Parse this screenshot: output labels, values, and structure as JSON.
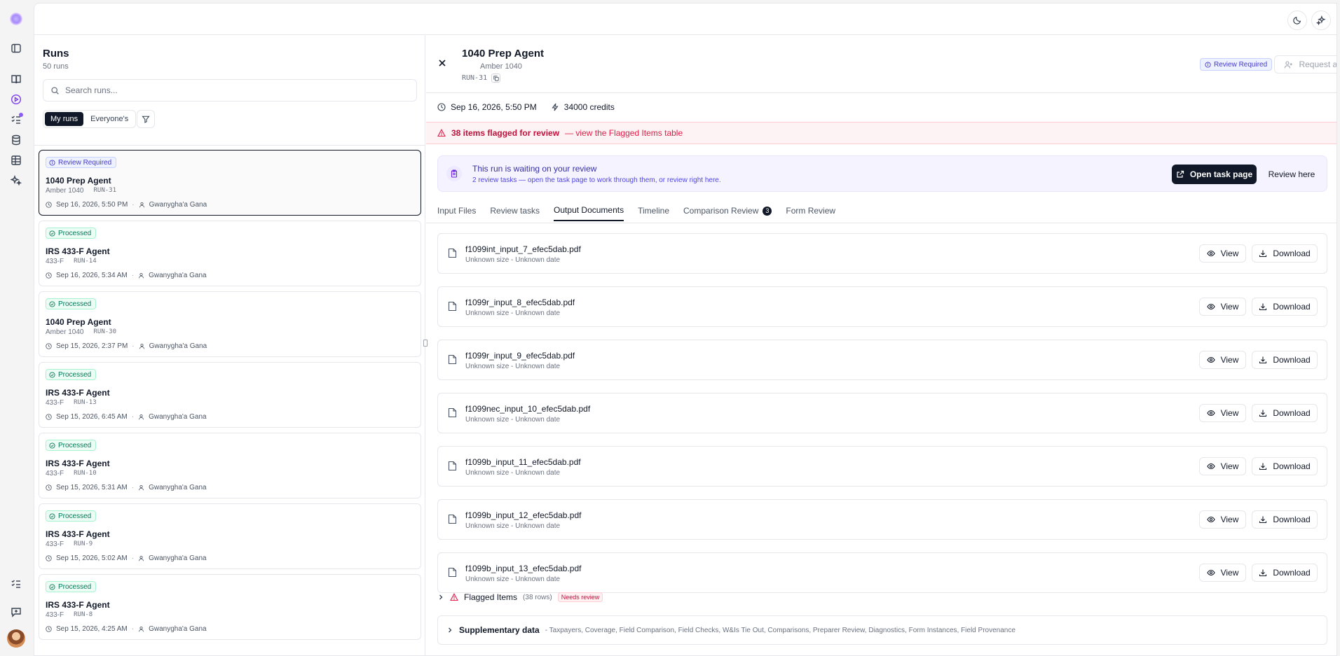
{
  "nav": {
    "icons": [
      "sidebar-toggle-icon",
      "book-icon",
      "play-circle-icon",
      "checklist-icon",
      "database-icon",
      "table-icon",
      "sparkles-icon",
      "checklist-icon",
      "message-plus-icon"
    ]
  },
  "topbar": {
    "icons": [
      "moon-icon",
      "sparkles-icon"
    ]
  },
  "runs": {
    "title": "Runs",
    "count": "50 runs",
    "search_placeholder": "Search runs...",
    "filter_my": "My runs",
    "filter_everyone": "Everyone's",
    "items": [
      {
        "status": "Review Required",
        "title": "1040 Prep Agent",
        "sub": "Amber 1040",
        "id": "RUN-31",
        "date": "Sep 16, 2026, 5:50 PM",
        "user": "Gwanygha'a Gana"
      },
      {
        "status": "Processed",
        "title": "IRS 433-F Agent",
        "sub": "433-F",
        "id": "RUN-14",
        "date": "Sep 16, 2026, 5:34 AM",
        "user": "Gwanygha'a Gana"
      },
      {
        "status": "Processed",
        "title": "1040 Prep Agent",
        "sub": "Amber 1040",
        "id": "RUN-30",
        "date": "Sep 15, 2026, 2:37 PM",
        "user": "Gwanygha'a Gana"
      },
      {
        "status": "Processed",
        "title": "IRS 433-F Agent",
        "sub": "433-F",
        "id": "RUN-13",
        "date": "Sep 15, 2026, 6:45 AM",
        "user": "Gwanygha'a Gana"
      },
      {
        "status": "Processed",
        "title": "IRS 433-F Agent",
        "sub": "433-F",
        "id": "RUN-10",
        "date": "Sep 15, 2026, 5:31 AM",
        "user": "Gwanygha'a Gana"
      },
      {
        "status": "Processed",
        "title": "IRS 433-F Agent",
        "sub": "433-F",
        "id": "RUN-9",
        "date": "Sep 15, 2026, 5:02 AM",
        "user": "Gwanygha'a Gana"
      },
      {
        "status": "Processed",
        "title": "IRS 433-F Agent",
        "sub": "433-F",
        "id": "RUN-8",
        "date": "Sep 15, 2026, 4:25 AM",
        "user": "Gwanygha'a Gana"
      }
    ]
  },
  "detail": {
    "title": "1040 Prep Agent",
    "subtitle": "Amber 1040",
    "run_id": "RUN-31",
    "status_badge": "Review Required",
    "request_approval": "Request approval",
    "date": "Sep 16, 2026, 5:50 PM",
    "credits": "34000 credits",
    "flag_bar": {
      "strong": "38 items flagged for review",
      "link": "— view the Flagged Items table"
    },
    "waiting": {
      "title": "This run is waiting on your review",
      "subtitle": "2 review tasks — open the task page to work through them, or review right here.",
      "open_button": "Open task page",
      "review_here": "Review here"
    },
    "tabs": [
      {
        "label": "Input Files"
      },
      {
        "label": "Review tasks"
      },
      {
        "label": "Output Documents"
      },
      {
        "label": "Timeline"
      },
      {
        "label": "Comparison Review",
        "count": "3"
      },
      {
        "label": "Form Review"
      }
    ],
    "documents": [
      {
        "name": "f1099int_input_7_efec5dab.pdf",
        "meta": "Unknown size - Unknown date"
      },
      {
        "name": "f1099r_input_8_efec5dab.pdf",
        "meta": "Unknown size - Unknown date"
      },
      {
        "name": "f1099r_input_9_efec5dab.pdf",
        "meta": "Unknown size - Unknown date"
      },
      {
        "name": "f1099nec_input_10_efec5dab.pdf",
        "meta": "Unknown size - Unknown date"
      },
      {
        "name": "f1099b_input_11_efec5dab.pdf",
        "meta": "Unknown size - Unknown date"
      },
      {
        "name": "f1099b_input_12_efec5dab.pdf",
        "meta": "Unknown size - Unknown date"
      },
      {
        "name": "f1099b_input_13_efec5dab.pdf",
        "meta": "Unknown size - Unknown date"
      }
    ],
    "view_label": "View",
    "download_label": "Download",
    "flagged": {
      "label": "Flagged Items",
      "rows": "(38 rows)",
      "badge": "Needs review"
    },
    "supplementary": {
      "label": "Supplementary data",
      "list": "- Taxpayers, Coverage, Field Comparison, Field Checks, W&Is Tie Out, Comparisons, Preparer Review, Diagnostics, Form Instances, Field Provenance"
    }
  }
}
